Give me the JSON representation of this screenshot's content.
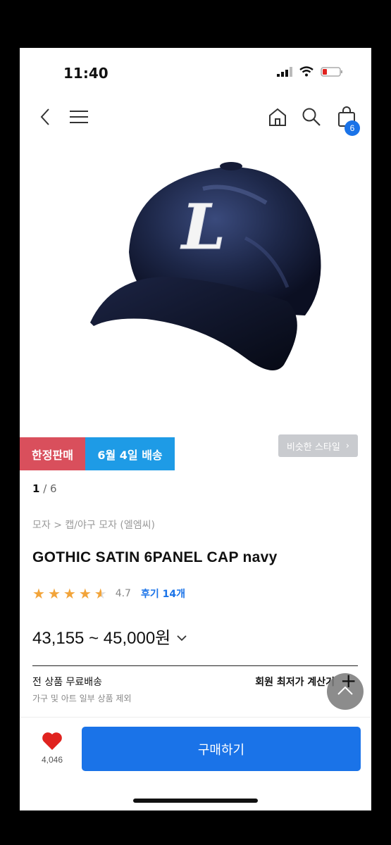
{
  "status_bar": {
    "time": "11:40"
  },
  "header": {
    "cart_count": "6"
  },
  "badges": {
    "limited": "한정판매",
    "delivery": "6월 4일 배송"
  },
  "similar_style": {
    "label": "비슷한 스타일",
    "chevron": "›"
  },
  "pager": {
    "current": "1",
    "separator": " / ",
    "total": "6"
  },
  "breadcrumb": "모자 > 캡/야구 모자 (엘엠씨)",
  "product": {
    "title": "GOTHIC SATIN 6PANEL CAP navy",
    "logo_letter": "L",
    "rating_value": "4.7",
    "rating_stars": 4.5,
    "review_label": "후기 14개",
    "price": "43,155 ~ 45,000원"
  },
  "shipping": {
    "title": "전 상품 무료배송",
    "subtitle": "가구 및 아트 일부 상품 제외",
    "member_calc": "회원 최저가 계산기"
  },
  "bottom": {
    "wish_count": "4,046",
    "buy_label": "구매하기"
  },
  "colors": {
    "accent": "#1a73e8",
    "limited": "#d94f5c",
    "delivery": "#1e9be6",
    "star": "#f2a43a",
    "heart": "#e0231f"
  },
  "icons": [
    "back-arrow-icon",
    "hamburger-menu-icon",
    "home-icon",
    "search-icon",
    "shopping-bag-icon",
    "heart-icon",
    "chevron-down-icon",
    "scroll-top-icon",
    "plus-icon"
  ]
}
